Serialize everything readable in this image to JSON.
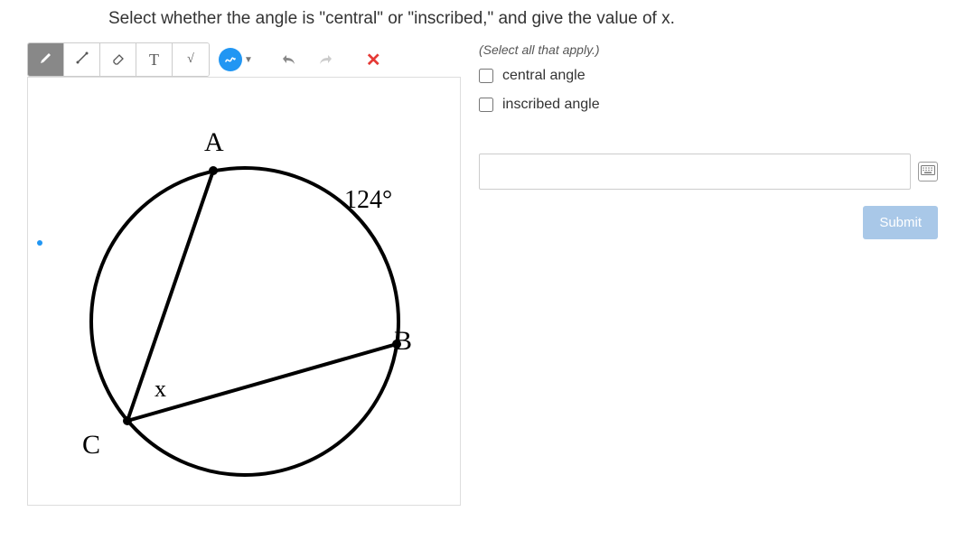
{
  "question": "Select whether the angle is \"central\" or \"inscribed,\" and give the value of x.",
  "rightPanel": {
    "instruction": "(Select all that apply.)",
    "options": [
      {
        "label": "central angle"
      },
      {
        "label": "inscribed angle"
      }
    ],
    "answerPlaceholder": "",
    "submitLabel": "Submit"
  },
  "toolbar": {
    "textToolLabel": "T",
    "sqrtToolLabel": "√",
    "clearLabel": "✕"
  },
  "diagram": {
    "labels": {
      "A": "A",
      "B": "B",
      "C": "C",
      "x": "x",
      "arc": "124°"
    }
  },
  "chart_data": {
    "type": "geometry-circle",
    "description": "Circle with inscribed angle at vertex C formed by chords CA and CB. Arc AB is labeled 124 degrees. Angle ACB is labeled x.",
    "vertices": [
      "A",
      "B",
      "C"
    ],
    "angle_vertex": "C",
    "angle_label": "x",
    "arc": {
      "from": "A",
      "to": "B",
      "measure_degrees": 124
    }
  }
}
